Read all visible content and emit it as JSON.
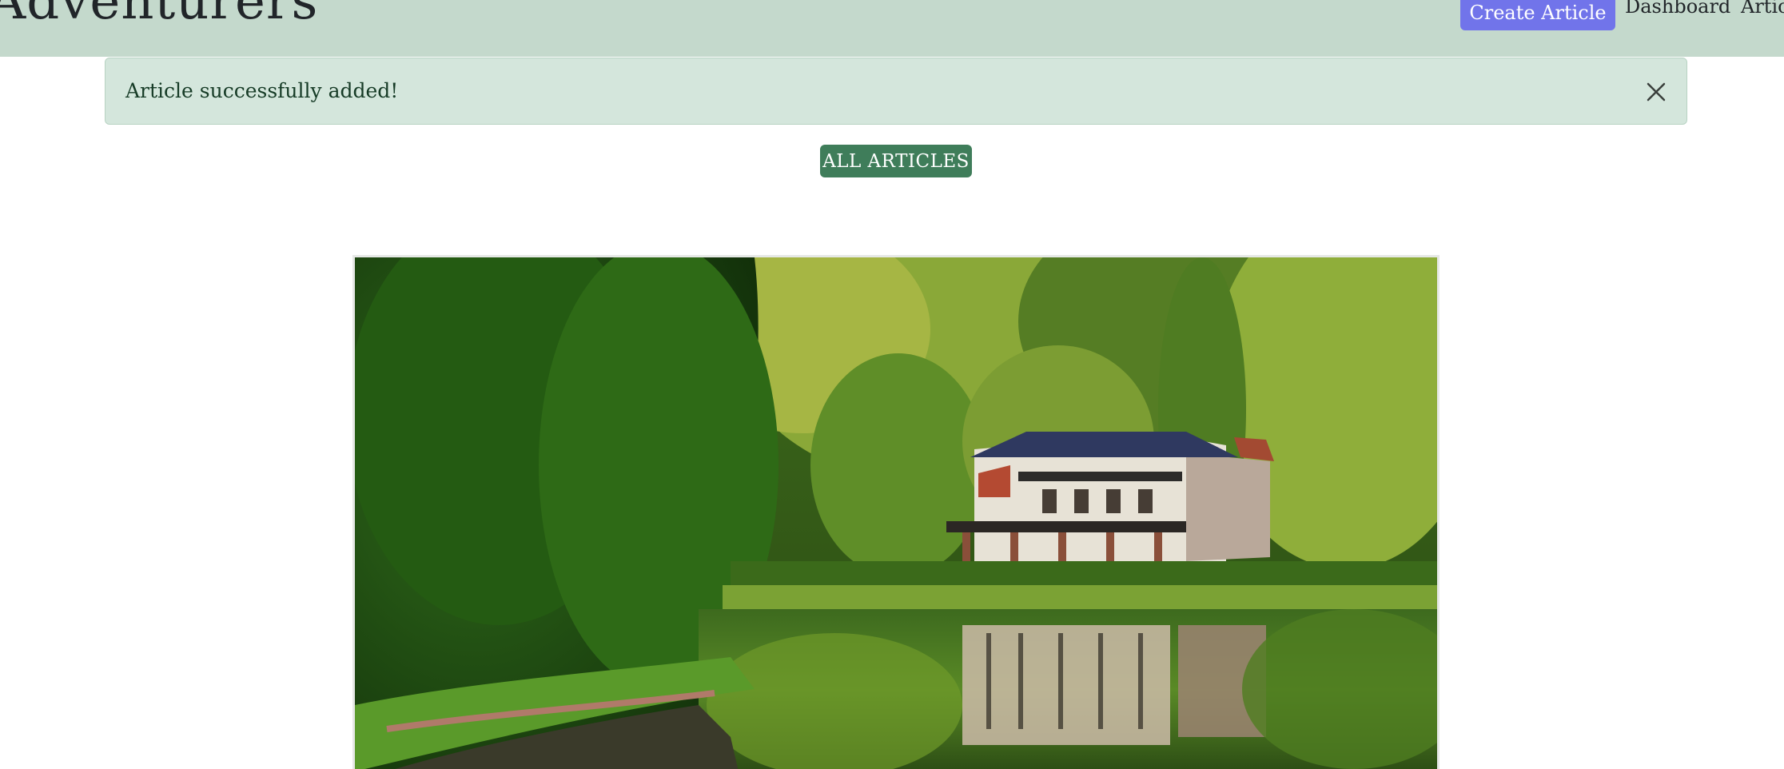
{
  "navbar": {
    "brand": "Adventurers",
    "create_label": "Create Article",
    "links": [
      "Dashboard",
      "Articles"
    ],
    "background": "#c4d9cc",
    "create_color": "#7174ea"
  },
  "alert": {
    "message": "Article successfully added!",
    "close_icon": "close-icon",
    "background": "#d4e6dc"
  },
  "badge": {
    "label": "ALL ARTICLES",
    "color": "#3f7d5a"
  },
  "article": {
    "image_icon": "lakeside-house-image"
  }
}
